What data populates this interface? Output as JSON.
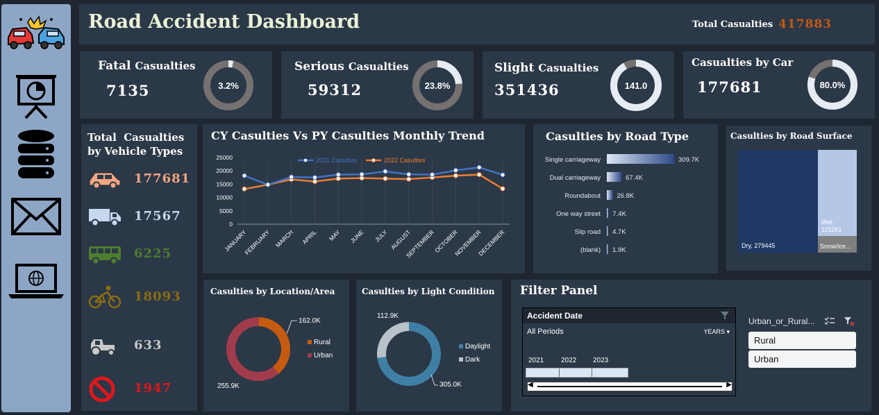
{
  "header": {
    "title": "Road Accident Dashboard",
    "total_label": "Total Casualties",
    "total_value": "417883"
  },
  "kpis": [
    {
      "title_big": "Fatal",
      "title_small": "Casualties",
      "value": "7135",
      "pct_label": "3.2%",
      "pct": 0.032
    },
    {
      "title_big": "Serious",
      "title_small": "Casualties",
      "value": "59312",
      "pct_label": "23.8%",
      "pct": 0.238
    },
    {
      "title_big": "Slight",
      "title_small": "Casualties",
      "value": "351436",
      "pct_label": "141.0",
      "pct": 0.918
    },
    {
      "title_big": "Casualties by Car",
      "title_small": "",
      "value": "177681",
      "pct_label": "80.0%",
      "pct": 0.8
    }
  ],
  "vehicles": {
    "title_line1": "Total  Casualties",
    "title_line2": "by Vehicle Types",
    "items": [
      {
        "icon": "car-icon",
        "value": "177681",
        "color": "#f4a582"
      },
      {
        "icon": "truck-icon",
        "value": "17567",
        "color": "#c6d8ef"
      },
      {
        "icon": "bus-icon",
        "value": "6225",
        "color": "#4f7d2f"
      },
      {
        "icon": "bicycle-icon",
        "value": "18093",
        "color": "#8c6d12"
      },
      {
        "icon": "tractor-icon",
        "value": "633",
        "color": "#c9c9c9"
      },
      {
        "icon": "no-entry-icon",
        "value": "1947",
        "color": "#e0171b"
      }
    ]
  },
  "trend": {
    "title": "CY Casulties Vs PY Casulties Monthly Trend",
    "chart_data": {
      "type": "line",
      "categories": [
        "JANUARY",
        "FEBRUARY",
        "MARCH",
        "APRIL",
        "MAY",
        "JUNE",
        "JULY",
        "AUGUST",
        "SEPTEMBER",
        "OCTOBER",
        "NOVEMBER",
        "DECEMBER"
      ],
      "series": [
        {
          "name": "2021 Casulties",
          "color": "#4472c4",
          "values": [
            18200,
            14800,
            17700,
            17500,
            18600,
            18700,
            19800,
            18700,
            18600,
            20200,
            21300,
            18500
          ]
        },
        {
          "name": "2022 Casulties",
          "color": "#ed7d31",
          "values": [
            13200,
            14800,
            16800,
            16000,
            17100,
            17300,
            17100,
            16900,
            17500,
            18200,
            18600,
            13300
          ]
        }
      ],
      "yticks": [
        "25000",
        "20000",
        "15000",
        "10000",
        "5000",
        "0"
      ],
      "ylim": [
        0,
        25000
      ]
    }
  },
  "road_type": {
    "title": "Casulties by Road Type",
    "chart_data": {
      "type": "bar",
      "categories": [
        "Single carriageway",
        "Dual carriageway",
        "Roundabout",
        "One way street",
        "Slip road",
        "(blank)"
      ],
      "values": [
        309.7,
        67.4,
        26.8,
        7.4,
        4.7,
        1.9
      ],
      "labels": [
        "309.7K",
        "67.4K",
        "26.8K",
        "7.4K",
        "4.7K",
        "1.9K"
      ]
    }
  },
  "road_surface": {
    "title": "Casulties by Road Surface",
    "chart_data": {
      "type": "treemap",
      "items": [
        {
          "label": "Dry, 279445",
          "value": 279445,
          "color": "#1f3864"
        },
        {
          "label": "Wet,",
          "label2": "115261",
          "value": 115261,
          "color": "#b4c7e7"
        },
        {
          "label": "Snow/Ice...",
          "value": 23177,
          "color": "#7f7f7f"
        }
      ]
    }
  },
  "location": {
    "title": "Casulties by Location/Area",
    "chart_data": {
      "type": "pie",
      "categories": [
        "Rural",
        "Urban"
      ],
      "values": [
        162.0,
        255.9
      ],
      "labels": [
        "162.0K",
        "255.9K"
      ],
      "colors": [
        "#c55a11",
        "#a03c4c"
      ]
    }
  },
  "light": {
    "title": "Casulties by Light Condition",
    "chart_data": {
      "type": "pie",
      "categories": [
        "Daylight",
        "Dark"
      ],
      "values": [
        305.0,
        112.9
      ],
      "labels": [
        "305.0K",
        "112.9K"
      ],
      "colors": [
        "#3f7fa5",
        "#b8c2c8"
      ]
    }
  },
  "filter": {
    "title": "Filter Panel",
    "date_title": "Accident Date",
    "all_periods": "All Periods",
    "years_label": "YEARS",
    "years": [
      "2021",
      "2022",
      "2023"
    ],
    "urban_title": "Urban_or_Rural...",
    "options": [
      "Rural",
      "Urban"
    ]
  }
}
